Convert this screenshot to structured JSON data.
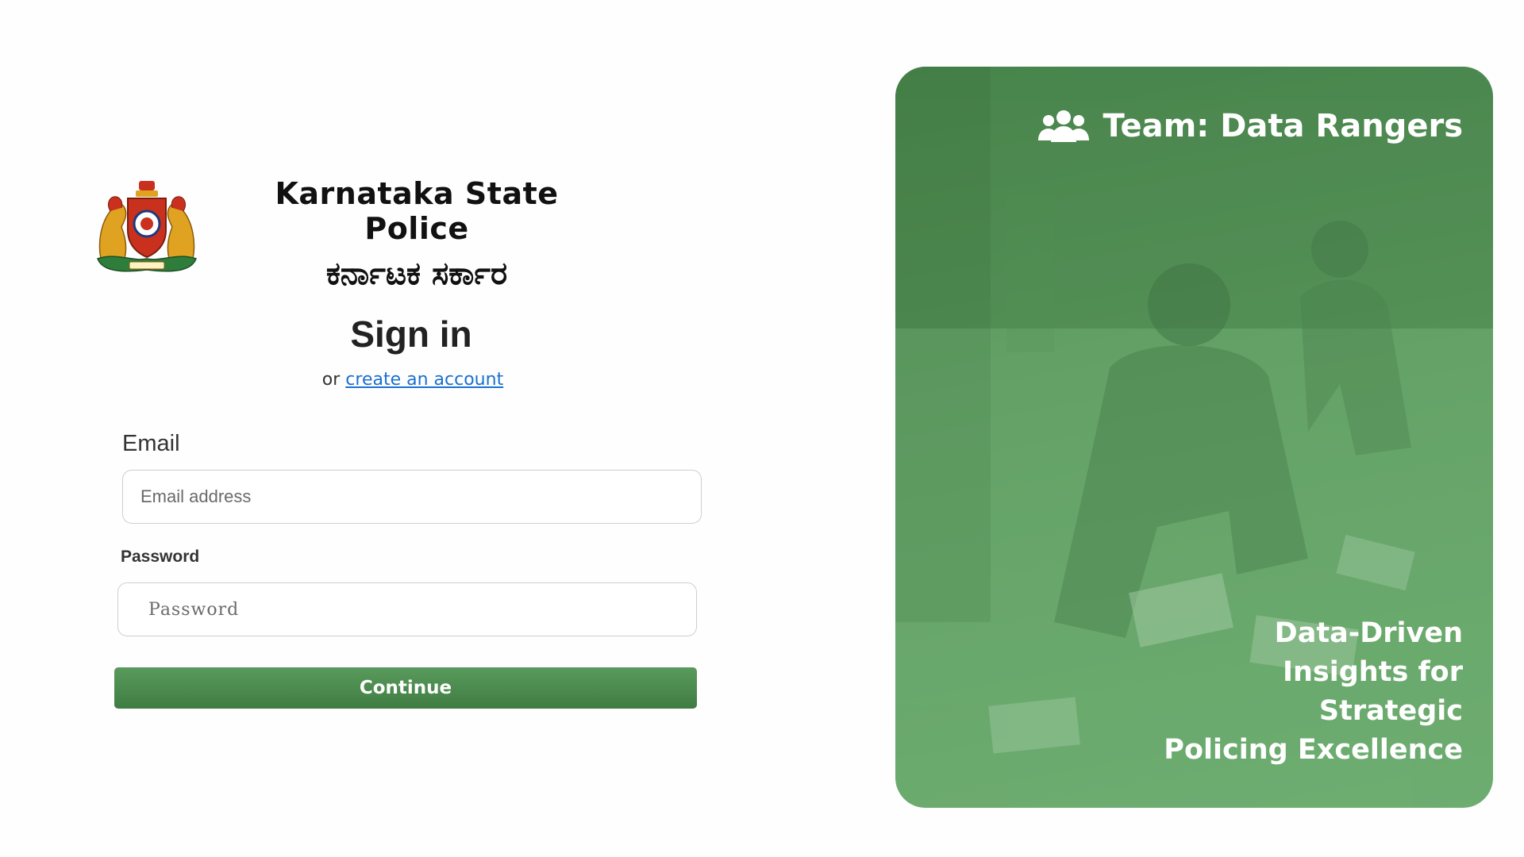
{
  "brand": {
    "title_en": "Karnataka State Police",
    "title_kn": "ಕರ್ನಾಟಕ ಸರ್ಕಾರ"
  },
  "signin": {
    "title": "Sign in",
    "or_text": "or",
    "create_account_link": "create an account"
  },
  "form": {
    "email_label": "Email",
    "email_placeholder": "Email address",
    "password_label": "Password",
    "password_placeholder": "Password",
    "continue_label": "Continue"
  },
  "hero": {
    "team_text": "Team: Data Rangers",
    "tagline_lines": [
      "Data-Driven",
      "Insights for",
      "Strategic",
      "Policing Excellence"
    ]
  },
  "colors": {
    "accent_green": "#4a8a4d",
    "link_blue": "#1a6fd0",
    "hero_green": "#5f9d62"
  }
}
